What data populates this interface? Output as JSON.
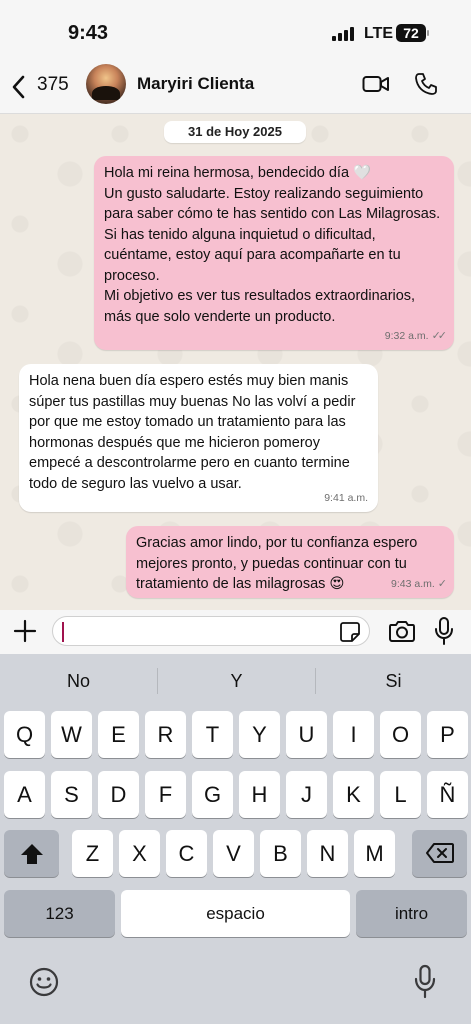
{
  "status_bar": {
    "time": "9:43",
    "network": "LTE",
    "battery": "72"
  },
  "header": {
    "back_count": "375",
    "contact_name": "Maryiri Clienta"
  },
  "chat": {
    "date_chip": "31 de Hoy 2025",
    "messages": [
      {
        "direction": "out",
        "text": "Hola mi reina hermosa, bendecido día 🤍\nUn gusto saludarte. Estoy realizando seguimiento para saber cómo te has sentido con Las Milagrosas.\nSi has tenido alguna inquietud o dificultad, cuéntame, estoy aquí para acompañarte en tu proceso.\nMi objetivo es ver tus resultados extraordinarios, más que solo venderte un producto.",
        "time": "9:32 a.m.",
        "ticks": "✓✓"
      },
      {
        "direction": "in",
        "text": "Hola nena buen día espero estés muy bien manis súper tus pastillas muy buenas No las volví a pedir por que me estoy tomado un tratamiento para las hormonas después que me hicieron pomeroy empecé a descontrolarme pero en cuanto termine todo de seguro las vuelvo a usar.",
        "time": "9:41 a.m."
      },
      {
        "direction": "out",
        "text": "Gracias amor lindo, por tu confianza espero mejores pronto, y puedas continuar con tu tratamiento de las milagrosas 😍",
        "time": "9:43 a.m.",
        "ticks": "✓"
      }
    ]
  },
  "input": {
    "placeholder": ""
  },
  "keyboard": {
    "suggestions": [
      "No",
      "Y",
      "Si"
    ],
    "row1": [
      "Q",
      "W",
      "E",
      "R",
      "T",
      "Y",
      "U",
      "I",
      "O",
      "P"
    ],
    "row2": [
      "A",
      "S",
      "D",
      "F",
      "G",
      "H",
      "J",
      "K",
      "L",
      "Ñ"
    ],
    "row3": [
      "Z",
      "X",
      "C",
      "V",
      "B",
      "N",
      "M"
    ],
    "numbers_label": "123",
    "space_label": "espacio",
    "return_label": "intro"
  },
  "icons": {
    "back": "chevron-left-icon",
    "video": "video-camera-icon",
    "call": "phone-icon",
    "plus": "plus-icon",
    "sticker": "sticker-icon",
    "camera": "camera-icon",
    "mic": "microphone-icon",
    "shift": "shift-arrow-icon",
    "delete": "backspace-icon",
    "emoji": "emoji-icon"
  },
  "colors": {
    "outgoing_bubble": "#f7c0d0",
    "incoming_bubble": "#ffffff",
    "chat_background": "#efeae2",
    "keyboard": "#d1d4da"
  }
}
